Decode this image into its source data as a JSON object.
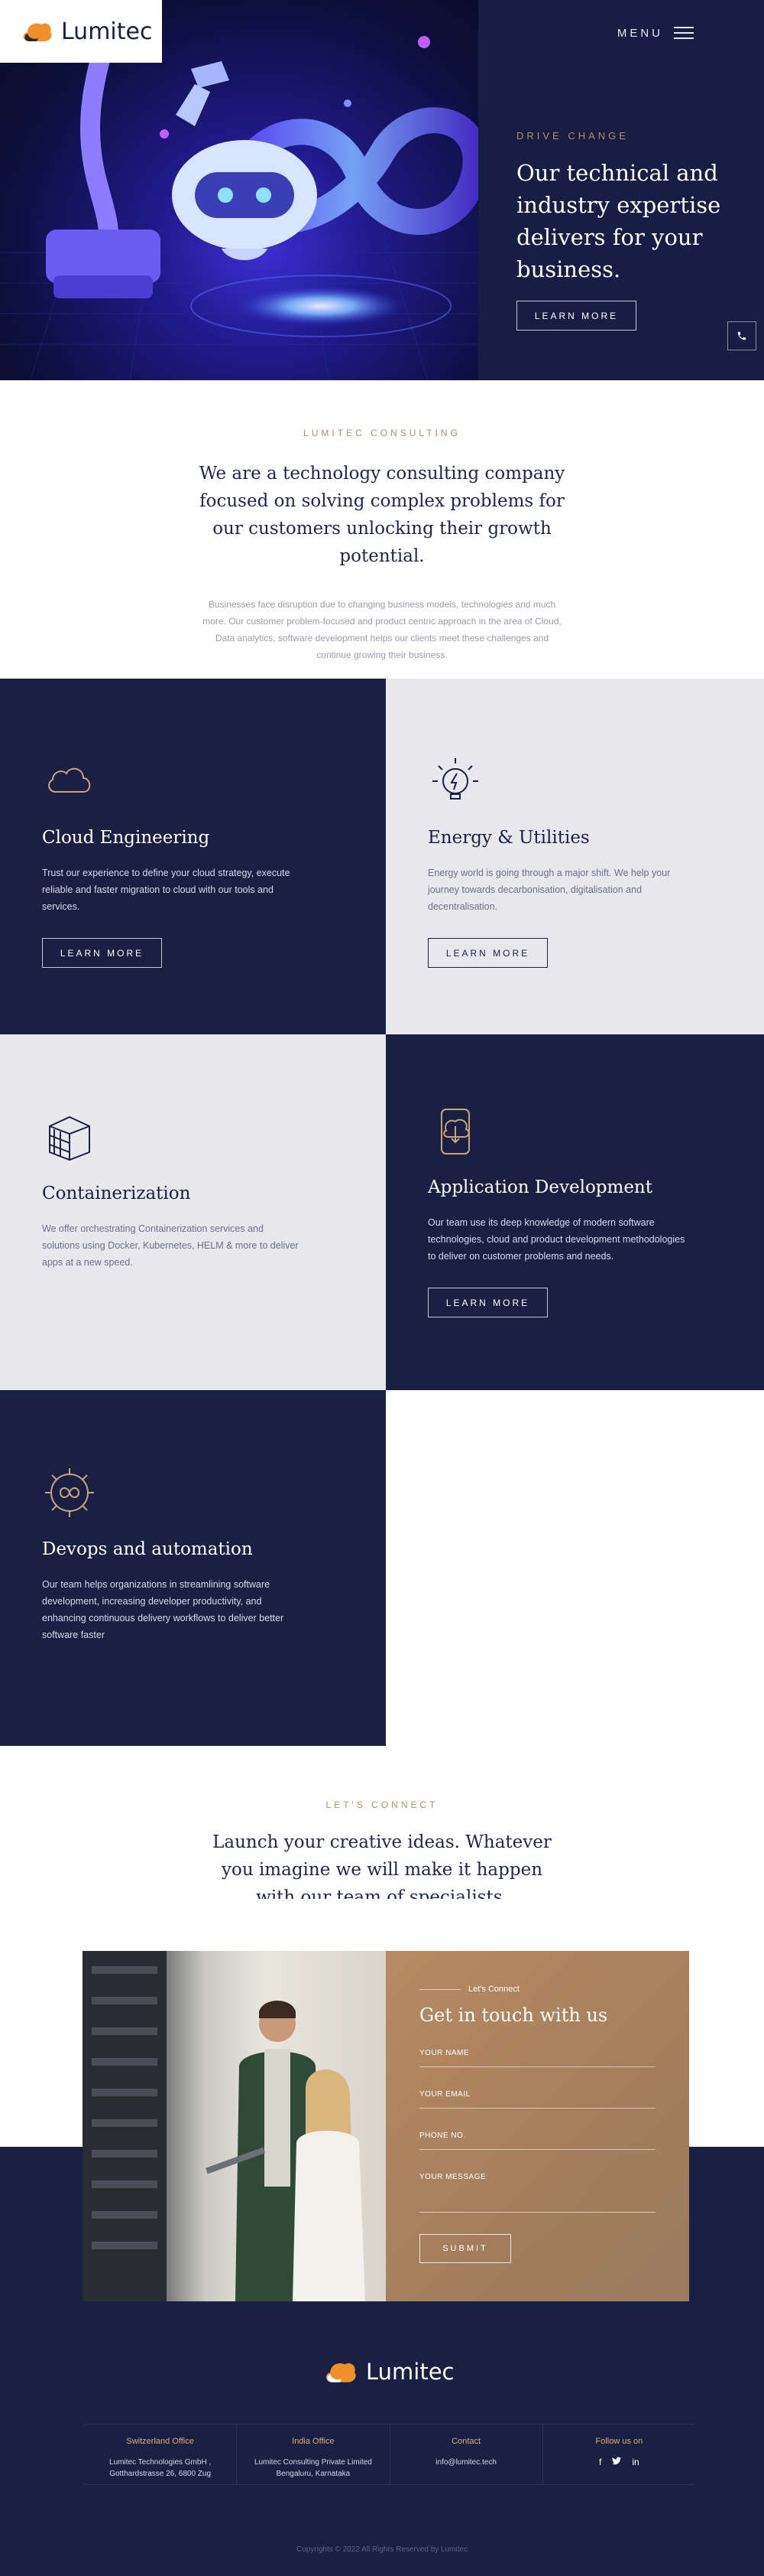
{
  "brand": {
    "name": "Lumitec"
  },
  "header": {
    "menu_label": "MENU"
  },
  "hero": {
    "kicker": "DRIVE CHANGE",
    "title": "Our technical and industry expertise delivers for your business.",
    "cta": "LEARN MORE"
  },
  "intro": {
    "kicker": "LUMITEC CONSULTING",
    "title": "We are a technology consulting company focused on solving complex problems for our customers unlocking their growth potential.",
    "body": "Businesses face disruption due to changing business models, technologies and much more. Our customer problem-focused and product centric approach in the area of Cloud, Data analytics, software development helps our clients meet these challenges and continue growing their business."
  },
  "services": [
    {
      "title": "Cloud Engineering",
      "icon": "cloud-icon",
      "text": "Trust our experience to define your cloud strategy, execute reliable and faster migration to cloud with our tools and services.",
      "cta": "LEARN MORE"
    },
    {
      "title": "Energy & Utilities",
      "icon": "lightbulb-icon",
      "text": "Energy world is going through a major shift. We help your journey towards decarbonisation, digitalisation and decentralisation.",
      "cta": "LEARN MORE"
    },
    {
      "title": "Containerization",
      "icon": "containers-icon",
      "text": "We offer orchestrating Containerization services and solutions using Docker, Kubernetes, HELM & more to deliver apps at a new speed."
    },
    {
      "title": "Application Development",
      "icon": "phone-download-icon",
      "text": "Our team use its deep knowledge of modern software technologies, cloud and product development methodologies to deliver on customer problems and needs.",
      "cta": "LEARN MORE"
    },
    {
      "title": "Devops and automation",
      "icon": "gear-infinity-icon",
      "text": "Our team helps organizations in streamlining software development, increasing developer productivity, and enhancing continuous delivery workflows to deliver better software faster"
    }
  ],
  "connect": {
    "kicker": "LET'S CONNECT",
    "title": "Launch your creative ideas. Whatever you imagine we will make it happen with our team of specialists."
  },
  "contact_form": {
    "kicker": "Let's Connect",
    "title": "Get in touch with us",
    "fields": [
      "YOUR NAME",
      "YOUR EMAIL",
      "PHONE NO.",
      "YOUR MESSAGE"
    ],
    "submit": "SUBMIT"
  },
  "footer": {
    "columns": [
      {
        "title": "Switzerland Office",
        "lines": [
          "Lumitec Technologies GmbH ,",
          "Gotthardstrasse 26, 6800 Zug"
        ]
      },
      {
        "title": "India Office",
        "lines": [
          "Lumitec Consulting Private Limited",
          "Bengaluru, Karnataka"
        ]
      },
      {
        "title": "Contact",
        "lines": [
          "info@lumitec.tech"
        ]
      },
      {
        "title": "Follow us on",
        "socials": [
          "f",
          "t",
          "in"
        ]
      }
    ],
    "copyright": "Copyrights © 2022 All Rights Reserved by Lumitec"
  },
  "colors": {
    "navy": "#1a1f44",
    "gold": "#b48f62",
    "light_grey": "#e8e8ec",
    "form_tan": "#a47e5c"
  }
}
